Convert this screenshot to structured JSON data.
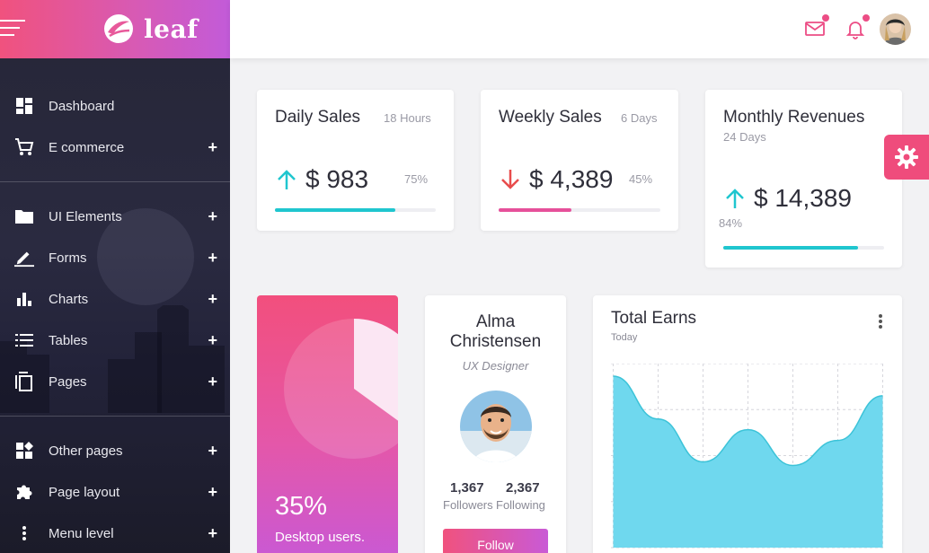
{
  "brand": {
    "name": "leaf"
  },
  "sidebar": {
    "items": [
      {
        "label": "Dashboard",
        "icon": "dashboard-icon",
        "has_children": false
      },
      {
        "label": "E commerce",
        "icon": "cart-icon",
        "has_children": true
      },
      {
        "label": "UI Elements",
        "icon": "folder-icon",
        "has_children": true
      },
      {
        "label": "Forms",
        "icon": "pencil-icon",
        "has_children": true
      },
      {
        "label": "Charts",
        "icon": "bar-chart-icon",
        "has_children": true
      },
      {
        "label": "Tables",
        "icon": "list-icon",
        "has_children": true
      },
      {
        "label": "Pages",
        "icon": "copy-icon",
        "has_children": true
      },
      {
        "label": "Other pages",
        "icon": "widgets-icon",
        "has_children": true
      },
      {
        "label": "Page layout",
        "icon": "puzzle-icon",
        "has_children": true
      },
      {
        "label": "Menu level",
        "icon": "more-vertical-icon",
        "has_children": true
      }
    ],
    "expand_symbol": "+"
  },
  "topbar": {
    "icons": [
      "mail-icon",
      "bell-icon"
    ],
    "accent": "#ec4d85"
  },
  "stats": [
    {
      "title": "Daily Sales",
      "period": "18 Hours",
      "value": "$ 983",
      "percent": "75%",
      "progress": 0.75,
      "trend": "up",
      "color": "#1fc6cf"
    },
    {
      "title": "Weekly Sales",
      "period": "6 Days",
      "value": "$ 4,389",
      "percent": "45%",
      "progress": 0.45,
      "trend": "down",
      "color": "#e6509a"
    },
    {
      "title": "Monthly Revenues",
      "period": "24 Days",
      "value": "$ 14,389",
      "percent": "84%",
      "progress": 0.84,
      "trend": "up",
      "color": "#1fc6cf"
    }
  ],
  "desktop": {
    "percent": "35%",
    "label": "Desktop users.",
    "share": 0.35
  },
  "profile": {
    "name_line1": "Alma",
    "name_line2": "Christensen",
    "role": "UX Designer",
    "followers_value": "1,367",
    "followers_label": "Followers",
    "following_value": "2,367",
    "following_label": "Following",
    "follow_label": "Follow"
  },
  "earnings": {
    "title": "Total Earns",
    "subtitle": "Today"
  },
  "chart_data": {
    "type": "area",
    "title": "Total Earns",
    "subtitle": "Today",
    "x": [
      0,
      1,
      2,
      3,
      4,
      5,
      6
    ],
    "values": [
      96,
      72,
      48,
      66,
      46,
      60,
      85
    ],
    "ylim": [
      0,
      100
    ],
    "grid": true,
    "color": "#6fd8ee",
    "stroke": "#3cc3d8"
  },
  "colors": {
    "brand_gradient_start": "#f0527e",
    "brand_gradient_end": "#c25bd9",
    "sidebar_bg": "#23233a",
    "teal": "#1fc6cf",
    "pink": "#e6509a",
    "trend_down": "#e84c4c"
  }
}
